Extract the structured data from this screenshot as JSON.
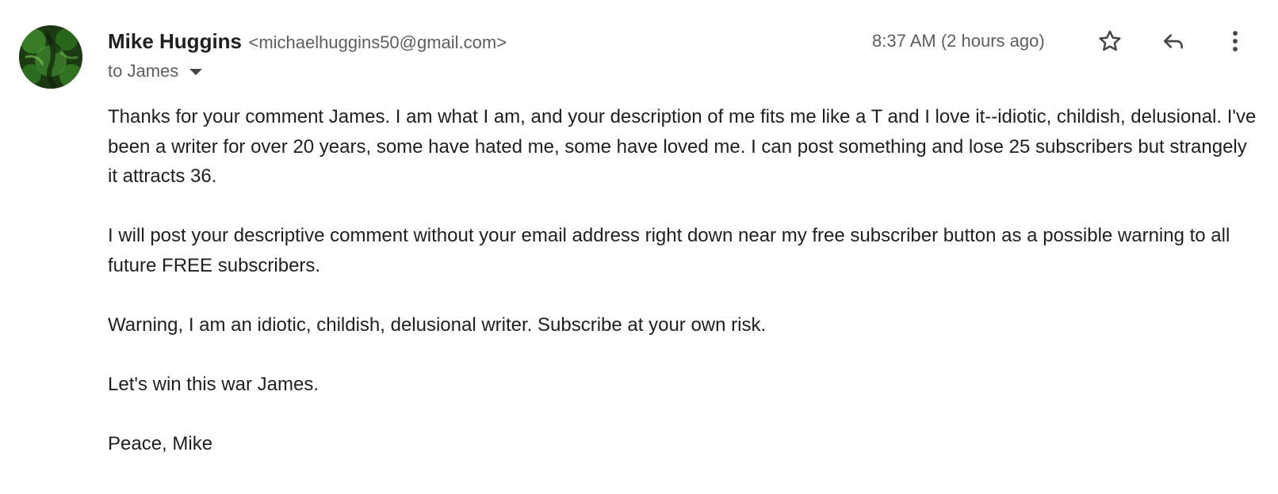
{
  "sender": {
    "name": "Mike Huggins",
    "email": "<michaelhuggins50@gmail.com>",
    "avatar": "green-textured-profile-photo"
  },
  "recipient": {
    "label": "to James",
    "expand_icon": "caret-down-icon"
  },
  "meta": {
    "timestamp": "8:37 AM (2 hours ago)"
  },
  "actions": {
    "star_icon": "star-icon",
    "reply_icon": "reply-icon",
    "more_icon": "more-vert-icon"
  },
  "body": {
    "paragraphs": [
      "Thanks for your comment James. I am what I am, and your description of me fits me like a T and I love it--idiotic, childish, delusional. I've been a writer for over 20 years, some have hated me, some have loved me. I can post something and lose 25 subscribers but strangely it attracts 36.",
      "I will post your descriptive comment without your email address right down near my free subscriber button as a possible warning to all future FREE subscribers.",
      "Warning, I am an idiotic, childish, delusional writer. Subscribe at your own risk.",
      "Let's win this war James.",
      "Peace, Mike"
    ]
  },
  "colors": {
    "text_primary": "#1f1f1f",
    "text_secondary": "#5e5e5e",
    "icon": "#444746",
    "avatar_green": "#2f7a22"
  }
}
